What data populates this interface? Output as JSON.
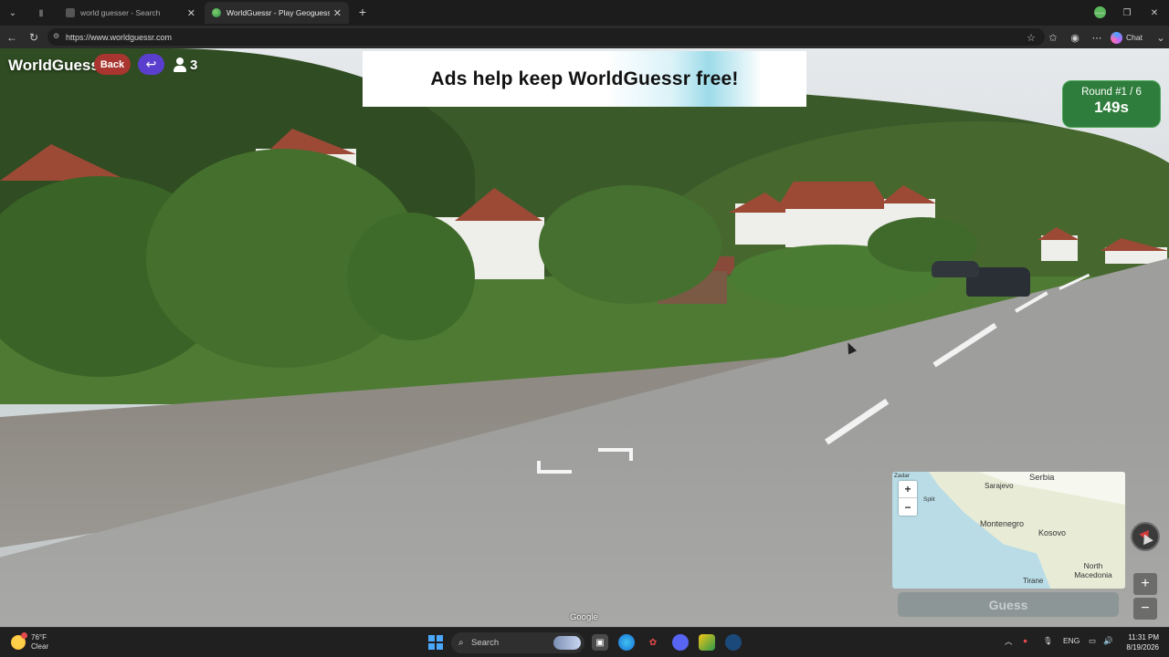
{
  "browser": {
    "tabs": [
      {
        "title": "world guesser - Search",
        "active": false
      },
      {
        "title": "WorldGuessr - Play Geoguessr for",
        "active": true
      }
    ],
    "url": "https://www.worldguessr.com",
    "chat_label": "Chat"
  },
  "game": {
    "brand": "WorldGuessr",
    "back_label": "Back",
    "player_count": "3",
    "ad_text": "Ads help keep WorldGuessr free!",
    "round_label": "Round #1 / 6",
    "timer": "149s",
    "guess_label": "Guess",
    "street_view_attribution": "Google"
  },
  "minimap": {
    "zoom_in": "+",
    "zoom_out": "−",
    "labels": [
      {
        "text": "Serbia"
      },
      {
        "text": "Sarajevo"
      },
      {
        "text": "Montenegro"
      },
      {
        "text": "Kosovo"
      },
      {
        "text": "North Macedonia"
      },
      {
        "text": "Tirane"
      },
      {
        "text": "Zadar"
      },
      {
        "text": "Split"
      }
    ]
  },
  "side_controls": {
    "zoom_in": "+",
    "zoom_out": "−"
  },
  "taskbar": {
    "weather_temp": "76°F",
    "weather_desc": "Clear",
    "search_label": "Search",
    "lang": "ENG",
    "time": "11:31 PM",
    "date": "8/19/2026"
  },
  "colors": {
    "back_button": "#a8352f",
    "undo_button": "#5a3fcf",
    "round_box": "#2f7d3c",
    "guess_button": "#8d9696"
  }
}
